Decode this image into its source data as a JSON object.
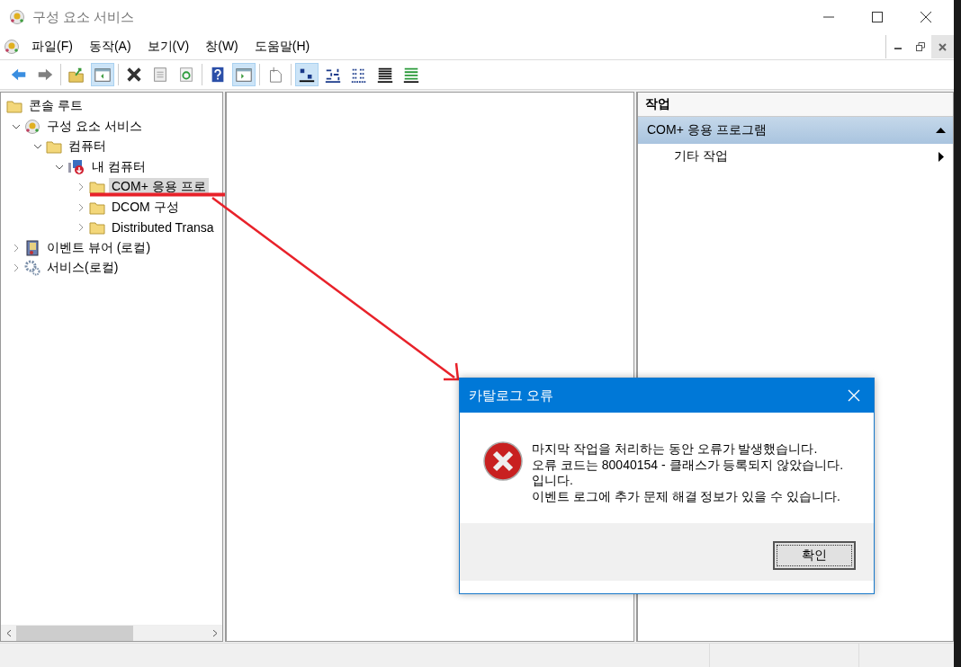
{
  "window": {
    "title": "구성 요소 서비스"
  },
  "menu": [
    "파일(F)",
    "동작(A)",
    "보기(V)",
    "창(W)",
    "도움말(H)"
  ],
  "toolbar": {
    "groups": [
      [
        {
          "kind": "back",
          "pressed": false
        },
        {
          "kind": "forward",
          "pressed": false
        }
      ],
      [
        {
          "kind": "up",
          "pressed": false
        },
        {
          "kind": "tree-pane",
          "pressed": true
        }
      ],
      [
        {
          "kind": "delete",
          "pressed": false
        },
        {
          "kind": "properties",
          "pressed": false
        },
        {
          "kind": "refresh",
          "pressed": false
        }
      ],
      [
        {
          "kind": "help",
          "pressed": false
        },
        {
          "kind": "action-pane",
          "pressed": true
        }
      ],
      [
        {
          "kind": "new",
          "pressed": false
        }
      ],
      [
        {
          "kind": "large-icons",
          "pressed": true
        },
        {
          "kind": "small-icons",
          "pressed": false
        },
        {
          "kind": "list",
          "pressed": false
        },
        {
          "kind": "details",
          "pressed": false
        },
        {
          "kind": "custom",
          "pressed": false
        }
      ]
    ]
  },
  "tree": [
    {
      "label": "콘솔 루트",
      "kind": "folder",
      "selected": false,
      "children": [
        {
          "label": "구성 요소 서비스",
          "kind": "component",
          "selected": false,
          "expanded": true,
          "children": [
            {
              "label": "컴퓨터",
              "kind": "folder",
              "selected": false,
              "expanded": true,
              "children": [
                {
                  "label": "내 컴퓨터",
                  "kind": "computer",
                  "selected": false,
                  "expanded": true,
                  "children": [
                    {
                      "label": "COM+ 응용 프로",
                      "kind": "folder",
                      "selected": true,
                      "expanded": false
                    },
                    {
                      "label": "DCOM 구성",
                      "kind": "folder",
                      "selected": false,
                      "expanded": false
                    },
                    {
                      "label": "Distributed Transa",
                      "kind": "folder",
                      "selected": false,
                      "expanded": false
                    }
                  ]
                }
              ]
            }
          ]
        },
        {
          "label": "이벤트 뷰어 (로컬)",
          "kind": "eventlog",
          "selected": false,
          "expanded": false
        },
        {
          "label": "서비스(로컬)",
          "kind": "gear",
          "selected": false,
          "expanded": false
        }
      ]
    }
  ],
  "actions": {
    "header": "작업",
    "sections": [
      {
        "title": "COM+ 응용 프로그램",
        "expanded": true,
        "items": [
          "기타 작업"
        ]
      }
    ]
  },
  "dialog": {
    "title": "카탈로그 오류",
    "message": [
      "마지막 작업을 처리하는 동안 오류가 발생했습니다.",
      "오류 코드는 80040154 - 클래스가 등록되지 않았습니다.",
      "입니다.",
      "이벤트 로그에 추가 문제 해결 정보가 있을 수 있습니다."
    ],
    "button": "확인"
  }
}
